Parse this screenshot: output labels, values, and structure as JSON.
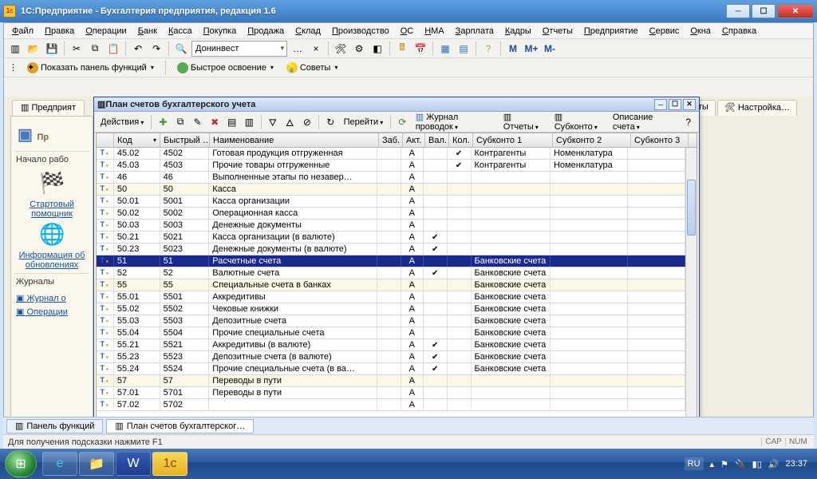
{
  "window": {
    "title": "1С:Предприятие - Бухгалтерия предприятия, редакция 1.6"
  },
  "menu": [
    "Файл",
    "Правка",
    "Операции",
    "Банк",
    "Касса",
    "Покупка",
    "Продажа",
    "Склад",
    "Производство",
    "ОС",
    "НМА",
    "Зарплата",
    "Кадры",
    "Отчеты",
    "Предприятие",
    "Сервис",
    "Окна",
    "Справка"
  ],
  "combo_org": "Донинвест",
  "m_buttons": [
    "M",
    "M+",
    "M-"
  ],
  "linkbar": {
    "show_panel": "Показать панель функций",
    "quick": "Быстрое освоение",
    "tips": "Советы"
  },
  "bgtab": "Предприят",
  "right_tabs": {
    "t1": "ты",
    "t2": "Настройка…"
  },
  "leftpanel": {
    "bigtitle": "Пр",
    "section1": "Начало рабо",
    "link1": "Стартовый помощник",
    "link2": "Информация об обновлениях",
    "section2": "Журналы",
    "j1": "Журнал о",
    "j2": "Операции"
  },
  "subwin": {
    "title": "План счетов бухгалтерского учета",
    "actions": "Действия",
    "goto": "Перейти",
    "journal": "Журнал проводок",
    "reports": "Отчеты",
    "subkonto": "Субконто",
    "desc": "Описание счета"
  },
  "columns": [
    "",
    "Код",
    "Быстрый …",
    "Наименование",
    "Заб.",
    "Акт.",
    "Вал.",
    "Кол.",
    "Субконто 1",
    "Субконто 2",
    "Субконто 3"
  ],
  "rows": [
    {
      "k": "45.02",
      "b": "4502",
      "n": "Готовая продукция отгруженная",
      "a": "А",
      "v": "",
      "kl": "✔",
      "s1": "Контрагенты",
      "s2": "Номенклатура",
      "alt": false
    },
    {
      "k": "45.03",
      "b": "4503",
      "n": "Прочие товары отгруженные",
      "a": "А",
      "v": "",
      "kl": "✔",
      "s1": "Контрагенты",
      "s2": "Номенклатура",
      "alt": false
    },
    {
      "k": "46",
      "b": "46",
      "n": "Выполненные этапы по незавер…",
      "a": "А",
      "v": "",
      "kl": "",
      "s1": "",
      "s2": "",
      "alt": false
    },
    {
      "k": "50",
      "b": "50",
      "n": "Касса",
      "a": "А",
      "v": "",
      "kl": "",
      "s1": "",
      "s2": "",
      "alt": true
    },
    {
      "k": "50.01",
      "b": "5001",
      "n": "Касса организации",
      "a": "А",
      "v": "",
      "kl": "",
      "s1": "",
      "s2": "",
      "alt": false
    },
    {
      "k": "50.02",
      "b": "5002",
      "n": "Операционная касса",
      "a": "А",
      "v": "",
      "kl": "",
      "s1": "",
      "s2": "",
      "alt": false
    },
    {
      "k": "50.03",
      "b": "5003",
      "n": "Денежные документы",
      "a": "А",
      "v": "",
      "kl": "",
      "s1": "",
      "s2": "",
      "alt": false
    },
    {
      "k": "50.21",
      "b": "5021",
      "n": "Касса организации (в валюте)",
      "a": "А",
      "v": "✔",
      "kl": "",
      "s1": "",
      "s2": "",
      "alt": false
    },
    {
      "k": "50.23",
      "b": "5023",
      "n": "Денежные документы (в валюте)",
      "a": "А",
      "v": "✔",
      "kl": "",
      "s1": "",
      "s2": "",
      "alt": false
    },
    {
      "k": "51",
      "b": "51",
      "n": "Расчетные счета",
      "a": "А",
      "v": "",
      "kl": "",
      "s1": "Банковские счета",
      "s2": "",
      "sel": true
    },
    {
      "k": "52",
      "b": "52",
      "n": "Валютные счета",
      "a": "А",
      "v": "✔",
      "kl": "",
      "s1": "Банковские счета",
      "s2": "",
      "alt": false
    },
    {
      "k": "55",
      "b": "55",
      "n": "Специальные счета в банках",
      "a": "А",
      "v": "",
      "kl": "",
      "s1": "Банковские счета",
      "s2": "",
      "alt": true
    },
    {
      "k": "55.01",
      "b": "5501",
      "n": "Аккредитивы",
      "a": "А",
      "v": "",
      "kl": "",
      "s1": "Банковские счета",
      "s2": "",
      "alt": false
    },
    {
      "k": "55.02",
      "b": "5502",
      "n": "Чековые книжки",
      "a": "А",
      "v": "",
      "kl": "",
      "s1": "Банковские счета",
      "s2": "",
      "alt": false
    },
    {
      "k": "55.03",
      "b": "5503",
      "n": "Депозитные счета",
      "a": "А",
      "v": "",
      "kl": "",
      "s1": "Банковские счета",
      "s2": "",
      "alt": false
    },
    {
      "k": "55.04",
      "b": "5504",
      "n": "Прочие специальные счета",
      "a": "А",
      "v": "",
      "kl": "",
      "s1": "Банковские счета",
      "s2": "",
      "alt": false
    },
    {
      "k": "55.21",
      "b": "5521",
      "n": "Аккредитивы (в валюте)",
      "a": "А",
      "v": "✔",
      "kl": "",
      "s1": "Банковские счета",
      "s2": "",
      "alt": false
    },
    {
      "k": "55.23",
      "b": "5523",
      "n": "Депозитные счета (в валюте)",
      "a": "А",
      "v": "✔",
      "kl": "",
      "s1": "Банковские счета",
      "s2": "",
      "alt": false
    },
    {
      "k": "55.24",
      "b": "5524",
      "n": "Прочие специальные счета (в ва…",
      "a": "А",
      "v": "✔",
      "kl": "",
      "s1": "Банковские счета",
      "s2": "",
      "alt": false
    },
    {
      "k": "57",
      "b": "57",
      "n": "Переводы в пути",
      "a": "А",
      "v": "",
      "kl": "",
      "s1": "",
      "s2": "",
      "alt": true
    },
    {
      "k": "57.01",
      "b": "5701",
      "n": "Переводы в пути",
      "a": "А",
      "v": "",
      "kl": "",
      "s1": "",
      "s2": "",
      "alt": false
    },
    {
      "k": "57.02",
      "b": "5702",
      "n": "",
      "a": "А",
      "v": "",
      "kl": "",
      "s1": "",
      "s2": "",
      "alt": false
    }
  ],
  "wintabs": {
    "t1": "Панель функций",
    "t2": "План счетов бухгалтерског…"
  },
  "status": {
    "hint": "Для получения подсказки нажмите F1",
    "cap": "CAP",
    "num": "NUM"
  },
  "tray": {
    "lang": "RU",
    "time": "23:37"
  }
}
